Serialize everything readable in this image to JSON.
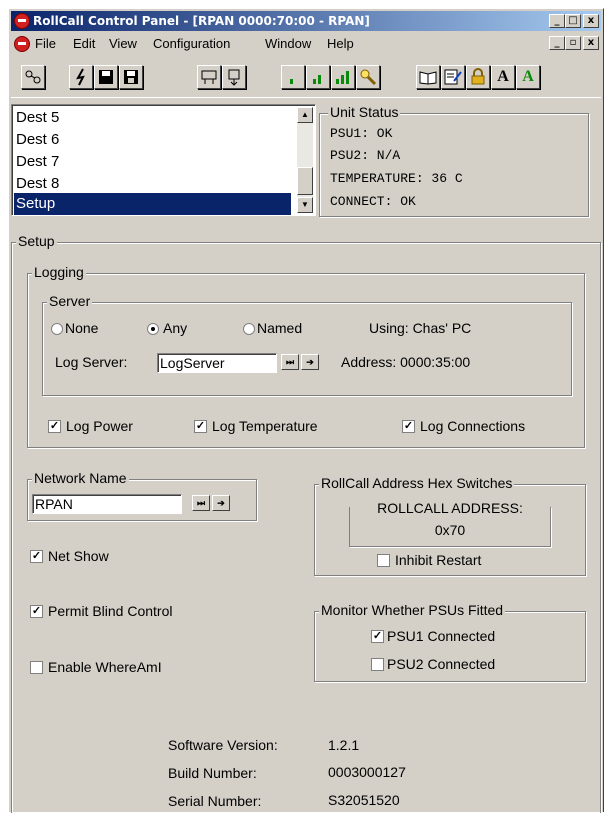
{
  "window": {
    "title": "RollCall Control Panel - [RPAN 0000:70:00 - RPAN]",
    "minimize": "_",
    "maximize": "□",
    "close": "x",
    "mdi_minimize": "_",
    "mdi_restore": "▫",
    "mdi_close": "x"
  },
  "menu": [
    "File",
    "Edit",
    "View",
    "Configuration",
    "Window",
    "Help"
  ],
  "toolbar": {
    "buttons": [
      "network-icon",
      "lightning-icon",
      "save-disk-icon",
      "save-all-icon",
      "scan-icon",
      "download-icon",
      "signal-low-icon",
      "signal-medium-icon",
      "signal-high-icon",
      "search-icon",
      "book-icon",
      "edit-form-icon",
      "lock-icon",
      "font-a-icon",
      "font-a-green-icon"
    ],
    "font_a": "A",
    "font_a_green": "A"
  },
  "dest_list": {
    "items": [
      "Dest 5",
      "Dest 6",
      "Dest 7",
      "Dest 8",
      "Setup"
    ],
    "selected": "Setup"
  },
  "unit_status": {
    "legend": "Unit Status",
    "lines": [
      "PSU1: OK",
      "PSU2: N/A",
      "TEMPERATURE: 36 C",
      "CONNECT: OK"
    ]
  },
  "setup": {
    "legend": "Setup",
    "logging": {
      "legend": "Logging",
      "server": {
        "legend": "Server",
        "radios": [
          {
            "label": "None",
            "selected": false
          },
          {
            "label": "Any",
            "selected": true
          },
          {
            "label": "Named",
            "selected": false
          }
        ],
        "using": "Using: Chas' PC",
        "log_server_label": "Log Server:",
        "log_server_value": "LogServer",
        "address": "Address: 0000:35:00"
      },
      "checks": [
        {
          "label": "Log Power",
          "checked": true
        },
        {
          "label": "Log Temperature",
          "checked": true
        },
        {
          "label": "Log Connections",
          "checked": true
        }
      ]
    },
    "network_name": {
      "legend": "Network Name",
      "value": "RPAN"
    },
    "hex_switches": {
      "legend": "RollCall Address Hex Switches",
      "address_label": "ROLLCALL ADDRESS:",
      "address_value": "0x70",
      "inhibit_restart": "Inhibit Restart",
      "inhibit_checked": false
    },
    "net_show": {
      "label": "Net Show",
      "checked": true
    },
    "permit_blind": {
      "label": "Permit Blind Control",
      "checked": true
    },
    "enable_whereami": {
      "label": "Enable WhereAmI",
      "checked": false
    },
    "psus": {
      "legend": "Monitor Whether PSUs Fitted",
      "psu1": {
        "label": "PSU1 Connected",
        "checked": true
      },
      "psu2": {
        "label": "PSU2 Connected",
        "checked": false
      }
    },
    "info": {
      "software_version_label": "Software Version:",
      "software_version": "1.2.1",
      "build_number_label": "Build Number:",
      "build_number": "0003000127",
      "serial_number_label": "Serial Number:",
      "serial_number": "S32051520"
    }
  },
  "colors": {
    "face": "#d4d0c8",
    "title_start": "#0a246a",
    "title_end": "#a6caf0",
    "selection": "#0a246a"
  },
  "glyphs": {
    "check": "✓",
    "arrow_right": "➔",
    "skip": "⏭",
    "scroll_up": "▲",
    "scroll_down": "▼"
  }
}
